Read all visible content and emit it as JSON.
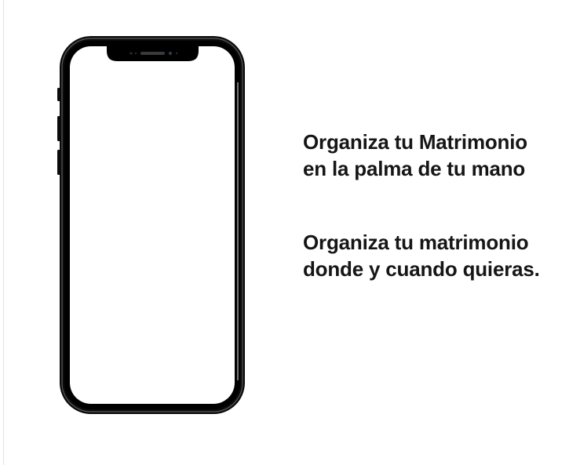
{
  "promo": {
    "headline_1": [
      "Organiza tu Matrimonio",
      "en la palma de tu mano"
    ],
    "headline_2": [
      "Organiza tu matrimonio",
      "donde y cuando quieras."
    ]
  },
  "phone": {
    "frame_color": "#0b0b0b",
    "screen_color": "#ffffff",
    "icon": "smartphone-mockup"
  }
}
